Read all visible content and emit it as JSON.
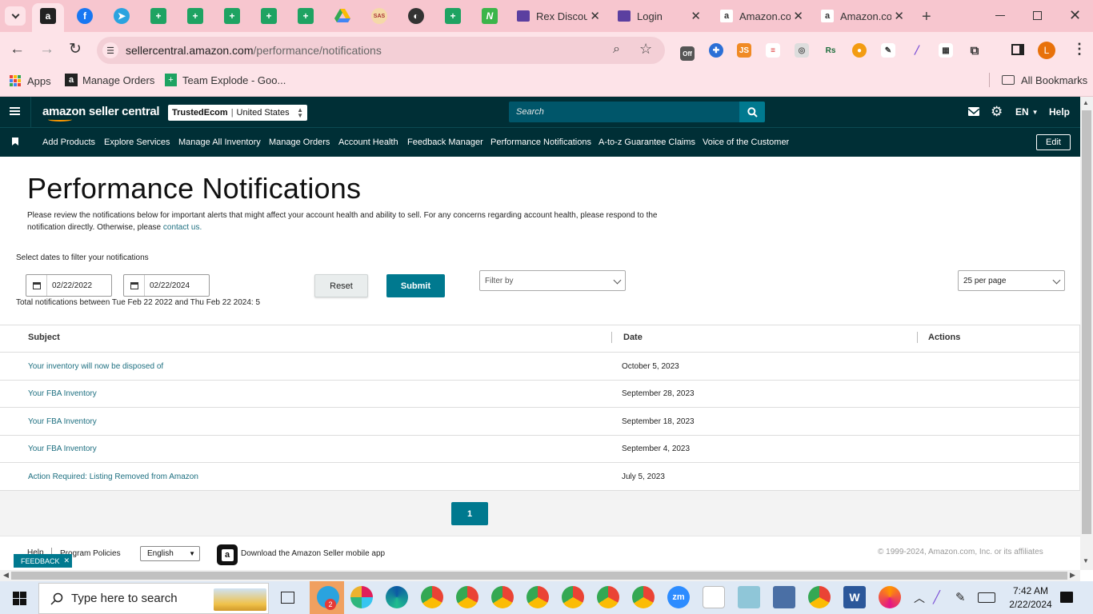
{
  "browser": {
    "tabs": [
      {
        "label": "Rex Discou",
        "icon": "rex-icon"
      },
      {
        "label": "Login",
        "icon": "rex-icon"
      },
      {
        "label": "Amazon.co",
        "icon": "amazon-icon"
      },
      {
        "label": "Amazon.co",
        "icon": "amazon-icon"
      }
    ],
    "url_host": "sellercentral.amazon.com",
    "url_path": "/performance/notifications",
    "bookmarks": [
      "Apps",
      "Manage Orders",
      "Team Explode - Goo..."
    ],
    "all_bookmarks": "All Bookmarks",
    "profile_initial": "L",
    "ext_off_label": "Off",
    "ext_js_label": "JS"
  },
  "header": {
    "logo": "amazon seller central",
    "account_name": "TrustedEcom",
    "account_region": "United States",
    "search_placeholder": "Search",
    "language": "EN",
    "help": "Help"
  },
  "nav": {
    "items": [
      "Add Products",
      "Explore Services",
      "Manage All Inventory",
      "Manage Orders",
      "Account Health",
      "Feedback Manager",
      "Performance Notifications",
      "A-to-z Guarantee Claims",
      "Voice of the Customer"
    ],
    "edit": "Edit"
  },
  "page": {
    "title": "Performance Notifications",
    "intro_line1": "Please review the notifications below for important alerts that might affect your account health and ability to sell. For any concerns regarding account health, please respond to the",
    "intro_line2_prefix": "notification directly. Otherwise, please ",
    "intro_link": "contact us.",
    "filter_label": "Select dates to filter your notifications",
    "date_from": "02/22/2022",
    "date_to": "02/22/2024",
    "reset": "Reset",
    "submit": "Submit",
    "filter_by": "Filter by",
    "per_page": "25 per page",
    "total_text": "Total notifications between Tue Feb 22 2022 and Thu Feb 22 2024: 5"
  },
  "table": {
    "headers": [
      "Subject",
      "Date",
      "Actions"
    ],
    "rows": [
      {
        "subject": "Your inventory will now be disposed of",
        "date": "October 5, 2023"
      },
      {
        "subject": "Your FBA Inventory",
        "date": "September 28, 2023"
      },
      {
        "subject": "Your FBA Inventory",
        "date": "September 18, 2023"
      },
      {
        "subject": "Your FBA Inventory",
        "date": "September 4, 2023"
      },
      {
        "subject": "Action Required: Listing Removed from Amazon",
        "date": "July 5, 2023"
      }
    ]
  },
  "pagination": {
    "current": "1"
  },
  "footer": {
    "help": "Help",
    "program_policies": "Program Policies",
    "language": "English",
    "app_text": "Download the Amazon Seller mobile app",
    "copyright": "© 1999-2024, Amazon.com, Inc. or its affiliates",
    "feedback": "FEEDBACK"
  },
  "taskbar": {
    "search_placeholder": "Type here to search",
    "time": "7:42 AM",
    "date": "2/22/2024",
    "telegram_badge": "2",
    "zoom_label": "zm"
  },
  "colors": {
    "header_bg": "#002f36",
    "search_bg": "#00566a",
    "accent_teal": "#00798f",
    "link": "#1d6f80",
    "chrome_pink": "#f7c6cf"
  }
}
